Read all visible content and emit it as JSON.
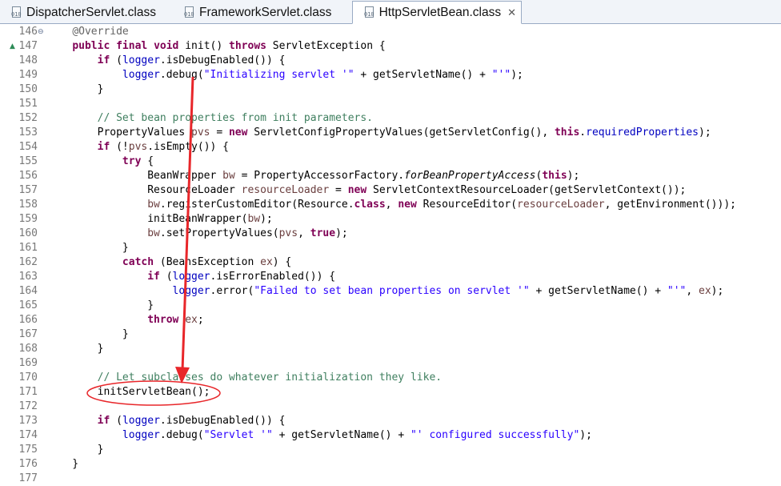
{
  "tabs": [
    {
      "label": "DispatcherServlet.class",
      "active": false
    },
    {
      "label": "FrameworkServlet.class",
      "active": false
    },
    {
      "label": "HttpServletBean.class",
      "active": true,
      "close": "✕"
    }
  ],
  "gutter_markers": {
    "fold": "⊖",
    "override": "▲"
  },
  "lines": [
    {
      "num": "146",
      "tokens": [
        [
          "",
          "    "
        ],
        [
          "ann",
          "@Override"
        ]
      ]
    },
    {
      "num": "147",
      "tokens": [
        [
          "",
          "    "
        ],
        [
          "kw",
          "public"
        ],
        [
          "",
          " "
        ],
        [
          "kw",
          "final"
        ],
        [
          "",
          " "
        ],
        [
          "kw",
          "void"
        ],
        [
          "",
          " init() "
        ],
        [
          "kw",
          "throws"
        ],
        [
          "",
          " ServletException {"
        ]
      ]
    },
    {
      "num": "148",
      "tokens": [
        [
          "",
          "        "
        ],
        [
          "kw",
          "if"
        ],
        [
          "",
          " ("
        ],
        [
          "fld",
          "logger"
        ],
        [
          "",
          ".isDebugEnabled()) {"
        ]
      ]
    },
    {
      "num": "149",
      "tokens": [
        [
          "",
          "            "
        ],
        [
          "fld",
          "logger"
        ],
        [
          "",
          ".debug("
        ],
        [
          "str",
          "\"Initializing servlet '\""
        ],
        [
          "",
          " + getServletName() + "
        ],
        [
          "str",
          "\"'\""
        ],
        [
          "",
          ");"
        ]
      ]
    },
    {
      "num": "150",
      "tokens": [
        [
          "",
          "        }"
        ]
      ]
    },
    {
      "num": "151",
      "tokens": [
        [
          "",
          ""
        ]
      ]
    },
    {
      "num": "152",
      "tokens": [
        [
          "",
          "        "
        ],
        [
          "cm",
          "// Set bean properties from init parameters."
        ]
      ]
    },
    {
      "num": "153",
      "tokens": [
        [
          "",
          "        PropertyValues "
        ],
        [
          "loc",
          "pvs"
        ],
        [
          "",
          " = "
        ],
        [
          "kw",
          "new"
        ],
        [
          "",
          " ServletConfigPropertyValues(getServletConfig(), "
        ],
        [
          "kw",
          "this"
        ],
        [
          "",
          "."
        ],
        [
          "fld",
          "requiredProperties"
        ],
        [
          "",
          ");"
        ]
      ]
    },
    {
      "num": "154",
      "tokens": [
        [
          "",
          "        "
        ],
        [
          "kw",
          "if"
        ],
        [
          "",
          " (!"
        ],
        [
          "loc",
          "pvs"
        ],
        [
          "",
          ".isEmpty()) {"
        ]
      ]
    },
    {
      "num": "155",
      "tokens": [
        [
          "",
          "            "
        ],
        [
          "kw",
          "try"
        ],
        [
          "",
          " {"
        ]
      ]
    },
    {
      "num": "156",
      "tokens": [
        [
          "",
          "                BeanWrapper "
        ],
        [
          "loc",
          "bw"
        ],
        [
          "",
          " = PropertyAccessorFactory."
        ],
        [
          "sta",
          "forBeanPropertyAccess"
        ],
        [
          "",
          "("
        ],
        [
          "kw",
          "this"
        ],
        [
          "",
          ");"
        ]
      ]
    },
    {
      "num": "157",
      "tokens": [
        [
          "",
          "                ResourceLoader "
        ],
        [
          "loc",
          "resourceLoader"
        ],
        [
          "",
          " = "
        ],
        [
          "kw",
          "new"
        ],
        [
          "",
          " ServletContextResourceLoader(getServletContext());"
        ]
      ]
    },
    {
      "num": "158",
      "tokens": [
        [
          "",
          "                "
        ],
        [
          "loc",
          "bw"
        ],
        [
          "",
          ".registerCustomEditor(Resource."
        ],
        [
          "kw",
          "class"
        ],
        [
          "",
          ", "
        ],
        [
          "kw",
          "new"
        ],
        [
          "",
          " ResourceEditor("
        ],
        [
          "loc",
          "resourceLoader"
        ],
        [
          "",
          ", getEnvironment()));"
        ]
      ]
    },
    {
      "num": "159",
      "tokens": [
        [
          "",
          "                initBeanWrapper("
        ],
        [
          "loc",
          "bw"
        ],
        [
          "",
          ");"
        ]
      ]
    },
    {
      "num": "160",
      "tokens": [
        [
          "",
          "                "
        ],
        [
          "loc",
          "bw"
        ],
        [
          "",
          ".setPropertyValues("
        ],
        [
          "loc",
          "pvs"
        ],
        [
          "",
          ", "
        ],
        [
          "kw",
          "true"
        ],
        [
          "",
          ");"
        ]
      ]
    },
    {
      "num": "161",
      "tokens": [
        [
          "",
          "            }"
        ]
      ]
    },
    {
      "num": "162",
      "tokens": [
        [
          "",
          "            "
        ],
        [
          "kw",
          "catch"
        ],
        [
          "",
          " (BeansException "
        ],
        [
          "loc",
          "ex"
        ],
        [
          "",
          ") {"
        ]
      ]
    },
    {
      "num": "163",
      "tokens": [
        [
          "",
          "                "
        ],
        [
          "kw",
          "if"
        ],
        [
          "",
          " ("
        ],
        [
          "fld",
          "logger"
        ],
        [
          "",
          ".isErrorEnabled()) {"
        ]
      ]
    },
    {
      "num": "164",
      "tokens": [
        [
          "",
          "                    "
        ],
        [
          "fld",
          "logger"
        ],
        [
          "",
          ".error("
        ],
        [
          "str",
          "\"Failed to set bean properties on servlet '\""
        ],
        [
          "",
          " + getServletName() + "
        ],
        [
          "str",
          "\"'\""
        ],
        [
          "",
          ", "
        ],
        [
          "loc",
          "ex"
        ],
        [
          "",
          ");"
        ]
      ]
    },
    {
      "num": "165",
      "tokens": [
        [
          "",
          "                }"
        ]
      ]
    },
    {
      "num": "166",
      "tokens": [
        [
          "",
          "                "
        ],
        [
          "kw",
          "throw"
        ],
        [
          "",
          " "
        ],
        [
          "loc",
          "ex"
        ],
        [
          "",
          ";"
        ]
      ]
    },
    {
      "num": "167",
      "tokens": [
        [
          "",
          "            }"
        ]
      ]
    },
    {
      "num": "168",
      "tokens": [
        [
          "",
          "        }"
        ]
      ]
    },
    {
      "num": "169",
      "tokens": [
        [
          "",
          ""
        ]
      ]
    },
    {
      "num": "170",
      "tokens": [
        [
          "",
          "        "
        ],
        [
          "cm",
          "// Let subclasses do whatever initialization they like."
        ]
      ]
    },
    {
      "num": "171",
      "tokens": [
        [
          "",
          "        initServletBean();"
        ]
      ]
    },
    {
      "num": "172",
      "tokens": [
        [
          "",
          ""
        ]
      ]
    },
    {
      "num": "173",
      "tokens": [
        [
          "",
          "        "
        ],
        [
          "kw",
          "if"
        ],
        [
          "",
          " ("
        ],
        [
          "fld",
          "logger"
        ],
        [
          "",
          ".isDebugEnabled()) {"
        ]
      ]
    },
    {
      "num": "174",
      "tokens": [
        [
          "",
          "            "
        ],
        [
          "fld",
          "logger"
        ],
        [
          "",
          ".debug("
        ],
        [
          "str",
          "\"Servlet '\""
        ],
        [
          "",
          " + getServletName() + "
        ],
        [
          "str",
          "\"' configured successfully\""
        ],
        [
          "",
          ");"
        ]
      ]
    },
    {
      "num": "175",
      "tokens": [
        [
          "",
          "        }"
        ]
      ]
    },
    {
      "num": "176",
      "tokens": [
        [
          "",
          "    }"
        ]
      ]
    },
    {
      "num": "177",
      "tokens": [
        [
          "",
          ""
        ]
      ]
    }
  ],
  "colors": {
    "annotation_red": "#e8262a",
    "keyword": "#7f0055",
    "string": "#2a00ff",
    "comment": "#3f7f5f",
    "field": "#0000c0",
    "local": "#6a3e3e"
  }
}
